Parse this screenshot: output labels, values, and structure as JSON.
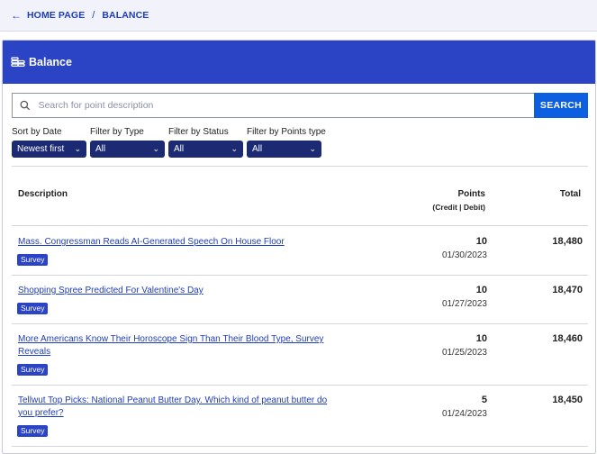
{
  "breadcrumb": {
    "home": "HOME PAGE",
    "separator": "/",
    "current": "BALANCE"
  },
  "card": {
    "title": "Balance",
    "icon": "coins-icon",
    "accent": "#2b44c6"
  },
  "search": {
    "placeholder": "Search for point description",
    "value": "",
    "button": "SEARCH"
  },
  "filters": [
    {
      "label": "Sort by Date",
      "value": "Newest first"
    },
    {
      "label": "Filter by Type",
      "value": "All"
    },
    {
      "label": "Filter by Status",
      "value": "All"
    },
    {
      "label": "Filter by Points type",
      "value": "All"
    }
  ],
  "table": {
    "col_description": "Description",
    "col_points": "Points",
    "col_points_sub": "(Credit | Debit)",
    "col_total": "Total",
    "rows": [
      {
        "description": "Mass. Congressman Reads AI-Generated Speech On House Floor",
        "tag": "Survey",
        "points": "10",
        "date": "01/30/2023",
        "total": "18,480"
      },
      {
        "description": "Shopping Spree Predicted For Valentine's Day",
        "tag": "Survey",
        "points": "10",
        "date": "01/27/2023",
        "total": "18,470"
      },
      {
        "description": "More Americans Know Their Horoscope Sign Than Their Blood Type, Survey Reveals",
        "tag": "Survey",
        "points": "10",
        "date": "01/25/2023",
        "total": "18,460"
      },
      {
        "description": "Tellwut Top Picks: National Peanut Butter Day. Which kind of peanut butter do you prefer?",
        "tag": "Survey",
        "points": "5",
        "date": "01/24/2023",
        "total": "18,450"
      }
    ]
  }
}
